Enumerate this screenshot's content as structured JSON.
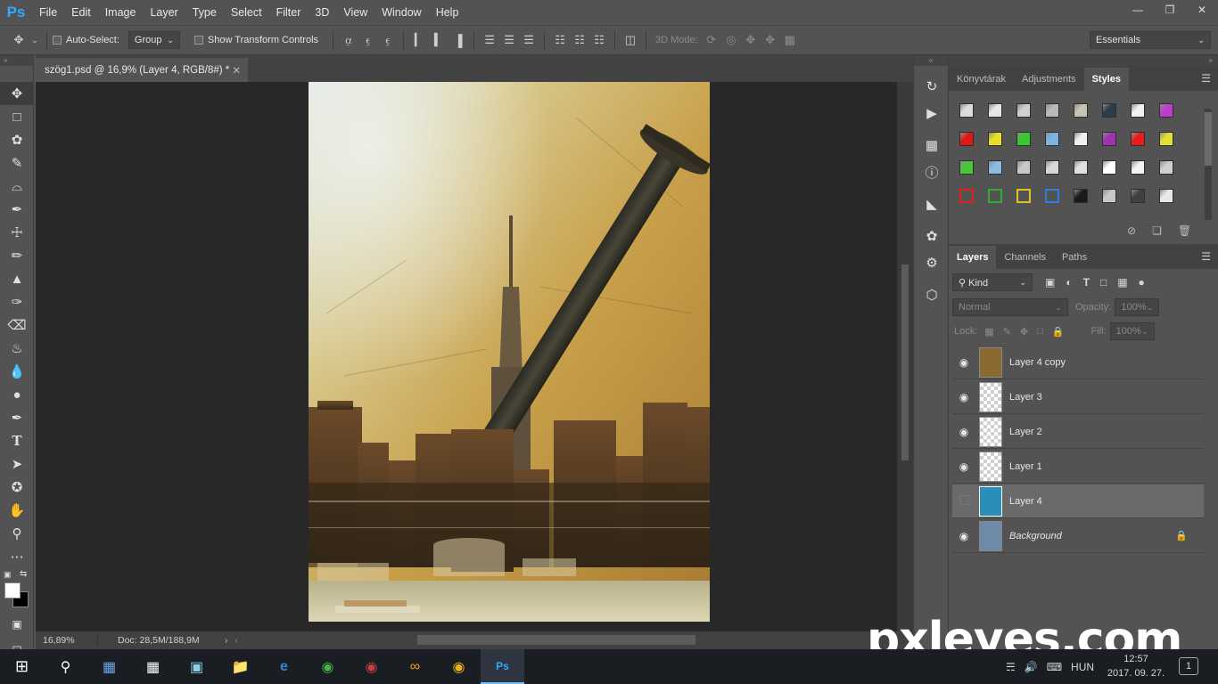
{
  "app": {
    "logo": "Ps"
  },
  "menu": [
    "File",
    "Edit",
    "Image",
    "Layer",
    "Type",
    "Select",
    "Filter",
    "3D",
    "View",
    "Window",
    "Help"
  ],
  "window_controls": [
    "minimize-icon",
    "restore-icon",
    "close-icon"
  ],
  "options": {
    "auto_select_label": "Auto-Select:",
    "auto_select_checked": false,
    "group_value": "Group",
    "show_transform_label": "Show Transform Controls",
    "show_transform_checked": false,
    "mode_3d_label": "3D Mode:",
    "workspace": "Essentials"
  },
  "document": {
    "tab_title": "szög1.psd @ 16,9% (Layer 4, RGB/8#) *",
    "zoom": "16,89%",
    "doc_info": "Doc: 28,5M/188,9M"
  },
  "tools": [
    "move-tool",
    "marquee-tool",
    "lasso-tool",
    "quick-select-tool",
    "crop-tool",
    "eyedropper-tool",
    "healing-tool",
    "brush-tool",
    "clone-stamp-tool",
    "history-brush-tool",
    "eraser-tool",
    "paint-bucket-tool",
    "blur-tool",
    "dodge-tool",
    "pen-tool",
    "type-tool",
    "path-select-tool",
    "shape-tool",
    "hand-tool",
    "zoom-tool",
    "more-tools"
  ],
  "styles_panel": {
    "tabs": [
      "Könyvtárak",
      "Adjustments",
      "Styles"
    ],
    "active_tab": "Styles",
    "swatch_colors": [
      [
        "#dcdcdc",
        "#e6e6e6",
        "#d0d0d0",
        "#b9b9b9",
        "#c8c4b4",
        "#2b3c4a",
        "#f2f2f2",
        "#c13cc8"
      ],
      [
        "#e01818",
        "#e8e020",
        "#38c830",
        "#7cb4e4",
        "#f0f0f0",
        "#a030b0",
        "#e81c1c",
        "#e0e030"
      ],
      [
        "#48c838",
        "#88bce0",
        "#c8c8c8",
        "#d8d8d8",
        "#e0e0e0",
        "#ffffff",
        "#f4f4f4",
        "#d0d0d0"
      ],
      [
        "#535353",
        "#535353",
        "#535353",
        "#535353",
        "#1a1a1a",
        "#c8c8c8",
        "#404040",
        "#e8e8e8"
      ]
    ],
    "swatch_outline_row": [
      "#e02020",
      "#30b030",
      "#e0c020",
      "#3080e0"
    ]
  },
  "layers_panel": {
    "tabs": [
      "Layers",
      "Channels",
      "Paths"
    ],
    "active_tab": "Layers",
    "kind_label": "Kind",
    "blend_mode": "Normal",
    "opacity_label": "Opacity:",
    "opacity_value": "100%",
    "lock_label": "Lock:",
    "fill_label": "Fill:",
    "fill_value": "100%",
    "layers": [
      {
        "name": "Layer 4 copy",
        "visible": true,
        "selected": false,
        "locked": false,
        "italic": false,
        "thumb": "#8a6a30"
      },
      {
        "name": "Layer 3",
        "visible": true,
        "selected": false,
        "locked": false,
        "italic": false,
        "thumb": "checker"
      },
      {
        "name": "Layer 2",
        "visible": true,
        "selected": false,
        "locked": false,
        "italic": false,
        "thumb": "checker"
      },
      {
        "name": "Layer 1",
        "visible": true,
        "selected": false,
        "locked": false,
        "italic": false,
        "thumb": "checker"
      },
      {
        "name": "Layer 4",
        "visible": false,
        "selected": true,
        "locked": false,
        "italic": false,
        "thumb": "#2a8fb8"
      },
      {
        "name": "Background",
        "visible": true,
        "selected": false,
        "locked": true,
        "italic": true,
        "thumb": "#6e8aa8"
      }
    ]
  },
  "taskbar": {
    "apps": [
      "start-icon",
      "search-icon",
      "store-icon",
      "calculator-icon",
      "notes-icon",
      "explorer-icon",
      "edge-icon",
      "utorrent-icon",
      "media-icon",
      "sync-icon",
      "chrome-icon",
      "photoshop-icon"
    ],
    "language": "HUN",
    "time": "12:57",
    "date": "2017. 09. 27.",
    "notifications": "1"
  },
  "watermark": "pxleyes.com"
}
